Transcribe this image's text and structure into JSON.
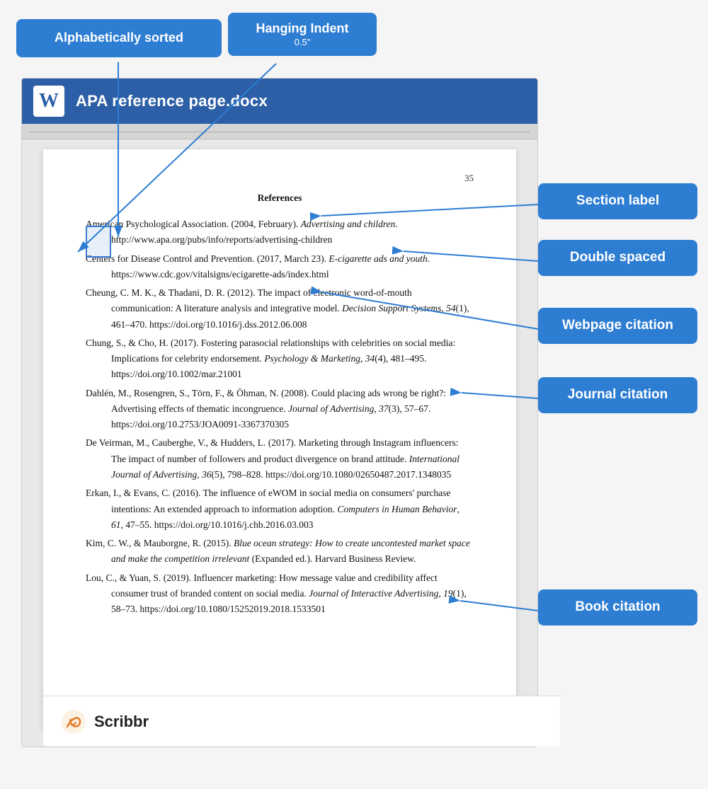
{
  "title": "APA reference page.docx",
  "page_number": "35",
  "references_heading": "References",
  "badges": {
    "alphabetically": "Alphabetically sorted",
    "hanging_indent": "Hanging Indent",
    "hanging_sub": "0.5\"",
    "section_label": "Section label",
    "double_spaced": "Double spaced",
    "webpage_citation": "Webpage citation",
    "journal_citation": "Journal citation",
    "book_citation": "Book citation"
  },
  "references": [
    {
      "id": "ref1",
      "text_parts": [
        {
          "text": "American Psychological Association. (2004, February). ",
          "style": "normal"
        },
        {
          "text": "Advertising and children",
          "style": "italic"
        },
        {
          "text": ". \n    http://www.apa.org/pubs/info/reports/advertising-children",
          "style": "normal"
        }
      ]
    },
    {
      "id": "ref2",
      "text_parts": [
        {
          "text": "Centers for Disease Control and Prevention. (2017, March 23). ",
          "style": "normal"
        },
        {
          "text": "E-cigarette ads and youth",
          "style": "italic"
        },
        {
          "text": ". \n    https://www.cdc.gov/vitalsigns/ecigarette-ads/index.html",
          "style": "normal"
        }
      ]
    },
    {
      "id": "ref3",
      "text_parts": [
        {
          "text": "Cheung, C. M. K., & Thadani, D. R. (2012). The impact of electronic word-of-mouth communication: A literature analysis and integrative model. ",
          "style": "normal"
        },
        {
          "text": "Decision Support Systems",
          "style": "italic"
        },
        {
          "text": ", ",
          "style": "normal"
        },
        {
          "text": "54",
          "style": "italic"
        },
        {
          "text": "(1), 461–470. https://doi.org/10.1016/j.dss.2012.06.008",
          "style": "normal"
        }
      ]
    },
    {
      "id": "ref4",
      "text_parts": [
        {
          "text": "Chung, S., & Cho, H. (2017). Fostering parasocial relationships with celebrities on social media: Implications for celebrity endorsement. ",
          "style": "normal"
        },
        {
          "text": "Psychology & Marketing",
          "style": "italic"
        },
        {
          "text": ", ",
          "style": "normal"
        },
        {
          "text": "34",
          "style": "italic"
        },
        {
          "text": "(4), 481–495. https://doi.org/10.1002/mar.21001",
          "style": "normal"
        }
      ]
    },
    {
      "id": "ref5",
      "text_parts": [
        {
          "text": "Dahlén, M., Rosengren, S., Törn, F., & Öhman, N. (2008). Could placing ads wrong be right?: Advertising effects of thematic incongruence. ",
          "style": "normal"
        },
        {
          "text": "Journal of Advertising",
          "style": "italic"
        },
        {
          "text": ", ",
          "style": "normal"
        },
        {
          "text": "37",
          "style": "italic"
        },
        {
          "text": "(3), 57–67. https://doi.org/10.2753/JOA0091-3367370305",
          "style": "normal"
        }
      ]
    },
    {
      "id": "ref6",
      "text_parts": [
        {
          "text": "De Veirman, M., Cauberghe, V., & Hudders, L. (2017). Marketing through Instagram influencers: The impact of number of followers and product divergence on brand attitude. ",
          "style": "normal"
        },
        {
          "text": "International Journal of Advertising",
          "style": "italic"
        },
        {
          "text": ", ",
          "style": "normal"
        },
        {
          "text": "36",
          "style": "italic"
        },
        {
          "text": "(5), 798–828. https://doi.org/10.1080/02650487.2017.1348035",
          "style": "normal"
        }
      ]
    },
    {
      "id": "ref7",
      "text_parts": [
        {
          "text": "Erkan, I., & Evans, C. (2016). The influence of eWOM in social media on consumers' purchase intentions: An extended approach to information adoption. ",
          "style": "normal"
        },
        {
          "text": "Computers in Human Behavior",
          "style": "italic"
        },
        {
          "text": ", ",
          "style": "normal"
        },
        {
          "text": "61",
          "style": "italic"
        },
        {
          "text": ", 47–55. https://doi.org/10.1016/j.chb.2016.03.003",
          "style": "normal"
        }
      ]
    },
    {
      "id": "ref8",
      "text_parts": [
        {
          "text": "Kim, C. W., & Mauborgne, R. (2015). ",
          "style": "normal"
        },
        {
          "text": "Blue ocean strategy: How to create uncontested market space and make the competition irrelevant",
          "style": "italic"
        },
        {
          "text": " (Expanded ed.). Harvard Business Review.",
          "style": "normal"
        }
      ]
    },
    {
      "id": "ref9",
      "text_parts": [
        {
          "text": "Lou, C., & Yuan, S. (2019). Influencer marketing: How message value and credibility affect consumer trust of branded content on social media. ",
          "style": "normal"
        },
        {
          "text": "Journal of Interactive Advertising",
          "style": "italic"
        },
        {
          "text": ", ",
          "style": "normal"
        },
        {
          "text": "19",
          "style": "italic"
        },
        {
          "text": "(1), 58–73. https://doi.org/10.1080/15252019.2018.1533501",
          "style": "normal"
        }
      ]
    }
  ],
  "scribbr": {
    "name": "Scribbr"
  }
}
